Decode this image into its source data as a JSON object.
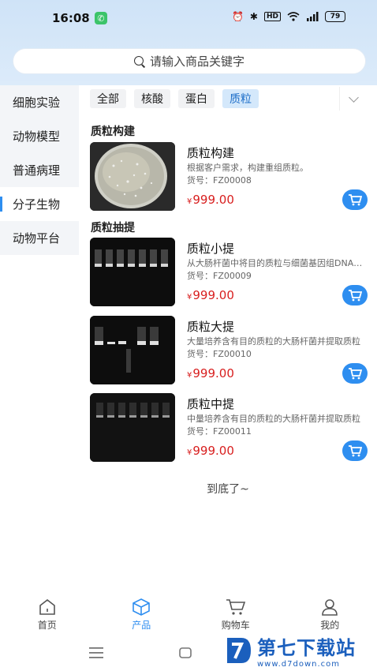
{
  "status_bar": {
    "time": "16:08",
    "battery": "79",
    "hd": "HD"
  },
  "search": {
    "placeholder": "请输入商品关键字"
  },
  "sidebar": {
    "items": [
      {
        "label": "细胞实验",
        "active": false
      },
      {
        "label": "动物模型",
        "active": false
      },
      {
        "label": "普通病理",
        "active": false
      },
      {
        "label": "分子生物",
        "active": true
      },
      {
        "label": "动物平台",
        "active": false
      }
    ]
  },
  "tabs": [
    {
      "label": "全部",
      "active": false
    },
    {
      "label": "核酸",
      "active": false
    },
    {
      "label": "蛋白",
      "active": false
    },
    {
      "label": "质粒",
      "active": true
    }
  ],
  "sections": [
    {
      "title": "质粒构建"
    },
    {
      "title": "质粒抽提"
    }
  ],
  "products": [
    {
      "name": "质粒构建",
      "desc": "根据客户需求，构建重组质粒。",
      "sku": "货号：FZ00008",
      "currency": "¥",
      "price": "999.00"
    },
    {
      "name": "质粒小提",
      "desc": "从大肠杆菌中将目的质粒与细菌基因组DNA分离",
      "sku": "货号：FZ00009",
      "currency": "¥",
      "price": "999.00"
    },
    {
      "name": "质粒大提",
      "desc": "大量培养含有目的质粒的大肠杆菌并提取质粒",
      "sku": "货号：FZ00010",
      "currency": "¥",
      "price": "999.00"
    },
    {
      "name": "质粒中提",
      "desc": "中量培养含有目的质粒的大肠杆菌并提取质粒",
      "sku": "货号：FZ00011",
      "currency": "¥",
      "price": "999.00"
    }
  ],
  "end_text": "到底了~",
  "bottom_nav": [
    {
      "label": "首页",
      "icon": "home-icon",
      "active": false
    },
    {
      "label": "产品",
      "icon": "box-icon",
      "active": true
    },
    {
      "label": "购物车",
      "icon": "cart-icon",
      "active": false
    },
    {
      "label": "我的",
      "icon": "user-icon",
      "active": false
    }
  ],
  "watermark": {
    "title": "第七下载站",
    "url": "www.d7down.com"
  },
  "colors": {
    "accent": "#2e8ef0",
    "price": "#d81e1e",
    "tab_active_bg": "#d4e8fb"
  }
}
